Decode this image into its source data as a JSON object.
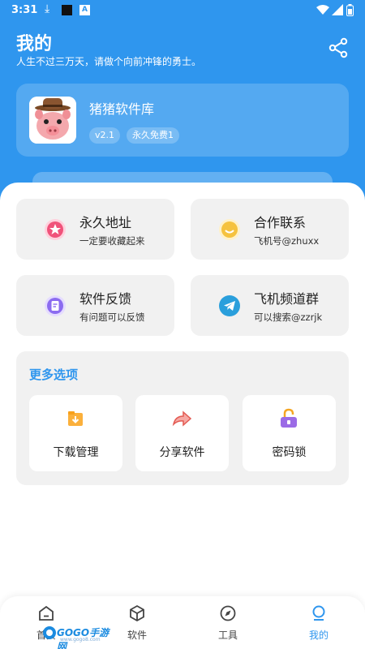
{
  "status_bar": {
    "time": "3:31",
    "icons": [
      "download-icon",
      "black-square-icon",
      "a-icon",
      "wifi-icon",
      "signal-icon",
      "battery-icon"
    ]
  },
  "header": {
    "title": "我的",
    "subtitle": "人生不过三万天，请做个向前冲锋的勇士。",
    "share_icon": "share-icon"
  },
  "profile": {
    "app_name": "猪猪软件库",
    "version": "v2.1",
    "tag": "永久免费1",
    "avatar": "pig-avatar"
  },
  "tiles": [
    {
      "title": "永久地址",
      "subtitle": "一定要收藏起来",
      "icon": "star-icon",
      "color": "#f0527a"
    },
    {
      "title": "合作联系",
      "subtitle": "飞机号@zhuxx",
      "icon": "smile-icon",
      "color": "#f5c23e"
    },
    {
      "title": "软件反馈",
      "subtitle": "有问题可以反馈",
      "icon": "feedback-icon",
      "color": "#8c6cf0"
    },
    {
      "title": "飞机频道群",
      "subtitle": "可以搜索@zzrjk",
      "icon": "telegram-icon",
      "color": "#2a9fdc"
    }
  ],
  "more": {
    "title": "更多选项",
    "options": [
      {
        "label": "下载管理",
        "icon": "download-folder-icon"
      },
      {
        "label": "分享软件",
        "icon": "share-arrow-icon"
      },
      {
        "label": "密码锁",
        "icon": "lock-icon"
      }
    ]
  },
  "tabbar": {
    "tabs": [
      {
        "label": "首页",
        "icon": "home-icon"
      },
      {
        "label": "软件",
        "icon": "cube-icon"
      },
      {
        "label": "工具",
        "icon": "compass-icon"
      },
      {
        "label": "我的",
        "icon": "user-icon",
        "active": true
      }
    ]
  },
  "watermark": {
    "text": "GOGO手游网",
    "sub": "www.gogo8.com"
  },
  "colors": {
    "primary": "#2f96ee",
    "tile_bg": "#f1f1f1",
    "text": "#222222"
  }
}
